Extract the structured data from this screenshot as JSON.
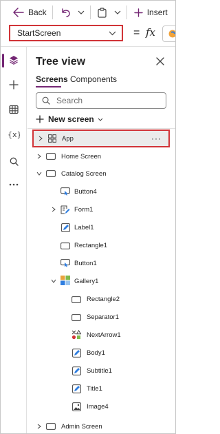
{
  "toolbar": {
    "back_label": "Back",
    "insert_label": "Insert"
  },
  "formula_bar": {
    "property_value": "StartScreen",
    "equals": "=",
    "fx": "fx"
  },
  "panel": {
    "title": "Tree view",
    "tabs": [
      "Screens",
      "Components"
    ],
    "search_placeholder": "Search",
    "new_screen_label": "New screen"
  },
  "tree": {
    "app": "App",
    "more": "···",
    "items": [
      "Home Screen",
      "Catalog Screen",
      "Button4",
      "Form1",
      "Label1",
      "Rectangle1",
      "Button1",
      "Gallery1",
      "Rectangle2",
      "Separator1",
      "NextArrow1",
      "Body1",
      "Subtitle1",
      "Title1",
      "Image4",
      "Admin Screen"
    ]
  },
  "colors": {
    "accent": "#742774",
    "highlight_border": "#d13438"
  }
}
